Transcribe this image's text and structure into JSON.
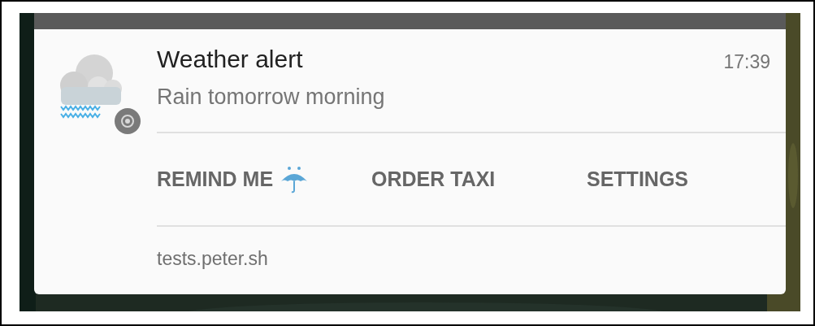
{
  "notification": {
    "title": "Weather alert",
    "time": "17:39",
    "text": "Rain tomorrow morning",
    "actions": [
      {
        "label": "REMIND ME",
        "kind": "icon-label"
      },
      {
        "label": "ORDER TAXI",
        "kind": "label"
      },
      {
        "label": "SETTINGS",
        "kind": "label"
      }
    ],
    "source": "tests.peter.sh"
  }
}
